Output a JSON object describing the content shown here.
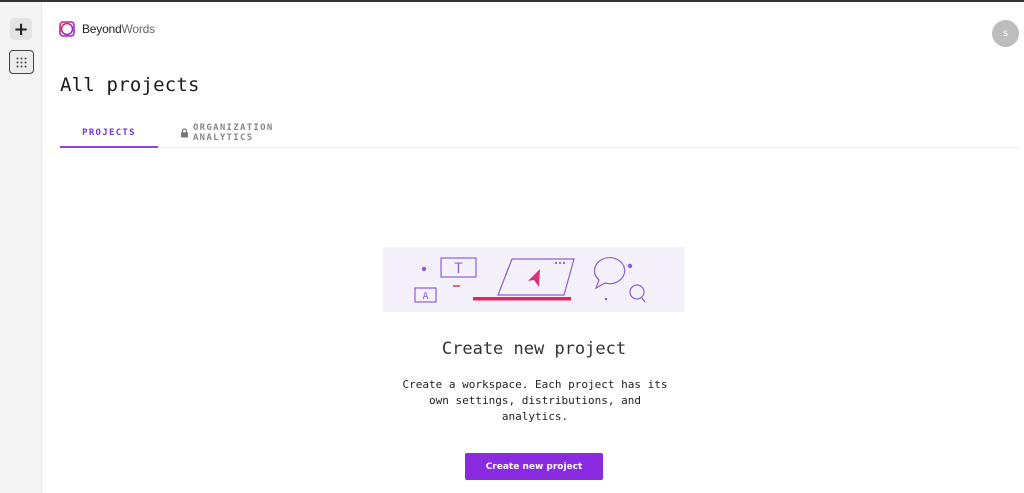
{
  "rail": {
    "add_label": "+",
    "apps_icon": "grid-icon"
  },
  "brand": {
    "name_bold": "Beyond",
    "name_light": "Words",
    "logo_icon": "beyondwords-logo-icon"
  },
  "avatar": {
    "initial": "s"
  },
  "page": {
    "title": "All projects"
  },
  "tabs": [
    {
      "label": "PROJECTS",
      "active": true
    },
    {
      "label": "ORGANIZATION ANALYTICS",
      "active": false,
      "icon": "lock-icon"
    }
  ],
  "empty_state": {
    "title": "Create new project",
    "description": "Create a workspace. Each project has its own settings, distributions, and analytics.",
    "button_label": "Create new project",
    "illustration": {
      "letters": [
        "T",
        "A"
      ]
    }
  },
  "colors": {
    "accent": "#8a2be2",
    "tab_active": "#7a33d6",
    "illustration_bg": "#f4f1fb",
    "illustration_line": "#8e5fd6",
    "illustration_highlight": "#e0245e"
  }
}
